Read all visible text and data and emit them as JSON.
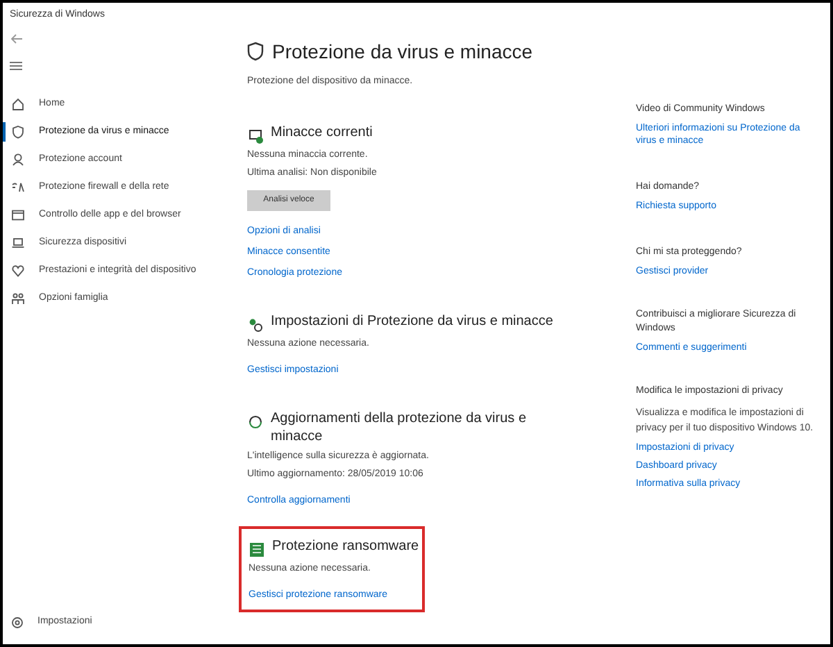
{
  "window": {
    "title": "Sicurezza di Windows"
  },
  "sidebar": {
    "items": [
      {
        "label": "Home",
        "kind": "home",
        "selected": false
      },
      {
        "label": "Protezione da virus e minacce",
        "kind": "shield",
        "selected": true
      },
      {
        "label": "Protezione account",
        "kind": "person",
        "selected": false
      },
      {
        "label": "Protezione firewall e della rete",
        "kind": "wifi",
        "selected": false
      },
      {
        "label": "Controllo delle app e del browser",
        "kind": "window",
        "selected": false
      },
      {
        "label": "Sicurezza dispositivi",
        "kind": "laptop",
        "selected": false
      },
      {
        "label": "Prestazioni e integrità del dispositivo",
        "kind": "heart",
        "selected": false
      },
      {
        "label": "Opzioni famiglia",
        "kind": "family",
        "selected": false
      }
    ],
    "settings": "Impostazioni"
  },
  "page": {
    "title": "Protezione da virus e minacce",
    "subtitle": "Protezione del dispositivo da minacce.",
    "sections": [
      {
        "kind": "threats",
        "title": "Minacce correnti",
        "lines": [
          "Nessuna minaccia corrente.",
          "Ultima analisi: Non disponibile"
        ],
        "button": "Analisi veloce",
        "links": [
          "Opzioni di analisi",
          "Minacce consentite",
          "Cronologia protezione"
        ],
        "highlighted": false
      },
      {
        "kind": "settings",
        "title": "Impostazioni di Protezione da virus e minacce",
        "lines": [
          "Nessuna azione necessaria."
        ],
        "links": [
          "Gestisci impostazioni"
        ],
        "highlighted": false
      },
      {
        "kind": "updates",
        "title": "Aggiornamenti della protezione da virus e minacce",
        "lines": [
          "L'intelligence sulla sicurezza è aggiornata.",
          "Ultimo aggiornamento: 28/05/2019 10:06"
        ],
        "links": [
          "Controlla aggiornamenti"
        ],
        "highlighted": false
      },
      {
        "kind": "ransomware",
        "title": "Protezione ransomware",
        "lines": [
          "Nessuna azione necessaria."
        ],
        "links": [
          "Gestisci protezione ransomware"
        ],
        "highlighted": true
      }
    ]
  },
  "aside": [
    {
      "heading": "Video di Community Windows",
      "links": [
        "Ulteriori informazioni su Protezione da virus e minacce"
      ]
    },
    {
      "heading": "Hai domande?",
      "links": [
        "Richiesta supporto"
      ]
    },
    {
      "heading": "Chi mi sta proteggendo?",
      "links": [
        "Gestisci provider"
      ]
    },
    {
      "heading": "Contribuisci a migliorare Sicurezza di Windows",
      "links": [
        "Commenti e suggerimenti"
      ]
    },
    {
      "heading": "Modifica le impostazioni di privacy",
      "text": "Visualizza e modifica le impostazioni di privacy per il tuo dispositivo Windows 10.",
      "links": [
        "Impostazioni di privacy",
        "Dashboard privacy",
        "Informativa sulla privacy"
      ]
    }
  ]
}
